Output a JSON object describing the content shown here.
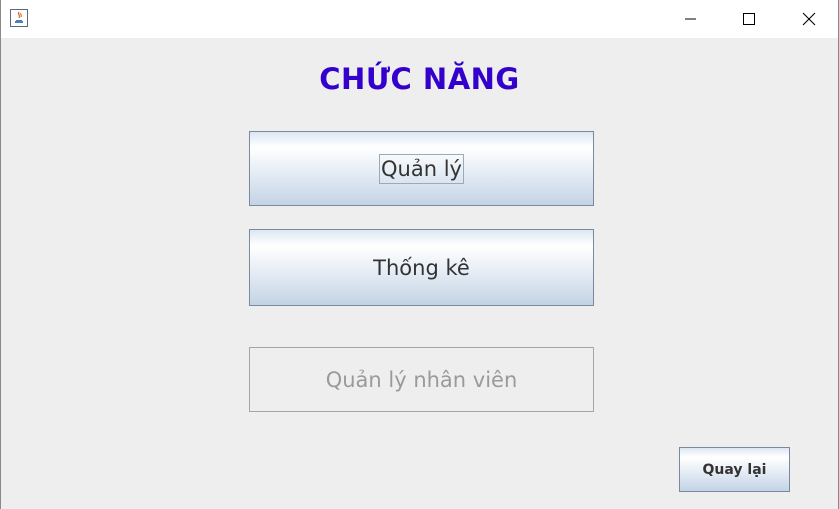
{
  "window": {
    "icon": "java-icon",
    "controls": [
      "minimize-icon",
      "maximize-icon",
      "close-icon"
    ]
  },
  "heading": "CHỨC NĂNG",
  "buttons": {
    "manage": "Quản lý",
    "statistics": "Thống kê",
    "staff_management": "Quản lý nhân viên",
    "back": "Quay lại"
  },
  "colors": {
    "heading": "#3300cc",
    "disabled_text": "#9a9a9a"
  }
}
